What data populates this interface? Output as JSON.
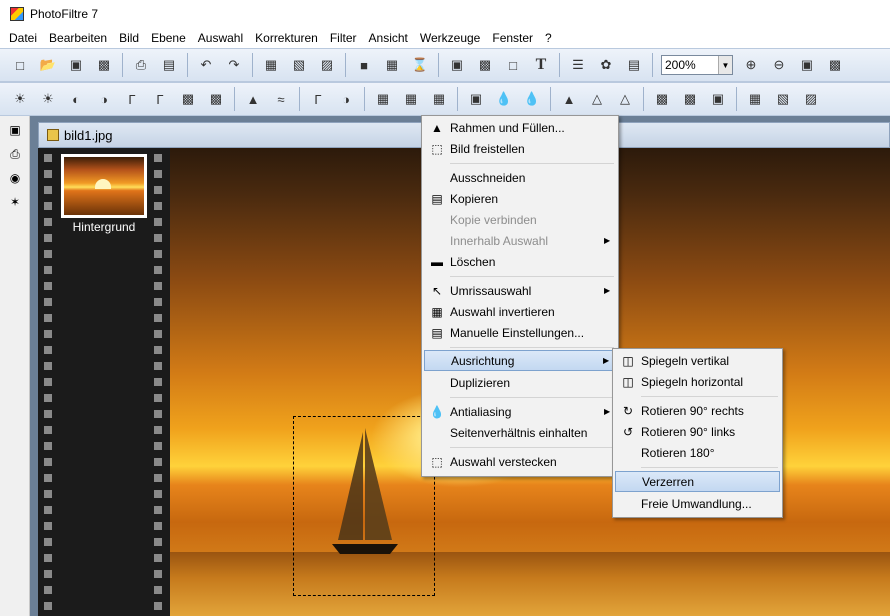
{
  "window": {
    "title": "PhotoFiltre 7"
  },
  "menubar": {
    "items": [
      "Datei",
      "Bearbeiten",
      "Bild",
      "Ebene",
      "Auswahl",
      "Korrekturen",
      "Filter",
      "Ansicht",
      "Werkzeuge",
      "Fenster",
      "?"
    ]
  },
  "toolbar": {
    "zoom_value": "200%"
  },
  "document": {
    "tab_title": "bild1.jpg"
  },
  "layers": {
    "layer_name": "Hintergrund"
  },
  "context_menu": {
    "items": [
      {
        "label": "Rahmen und Füllen...",
        "icon": "paint-bucket-icon",
        "enabled": true
      },
      {
        "label": "Bild freistellen",
        "icon": "crop-selection-icon",
        "enabled": true
      },
      {
        "label": "Ausschneiden",
        "enabled": true
      },
      {
        "label": "Kopieren",
        "icon": "copy-image-icon",
        "enabled": true
      },
      {
        "label": "Kopie verbinden",
        "enabled": false
      },
      {
        "label": "Innerhalb Auswahl",
        "enabled": false,
        "submenu": true
      },
      {
        "label": "Löschen",
        "icon": "eraser-icon",
        "enabled": true
      },
      {
        "label": "Umrissauswahl",
        "icon": "cursor-icon",
        "enabled": true,
        "submenu": true
      },
      {
        "label": "Auswahl invertieren",
        "icon": "invert-selection-icon",
        "enabled": true
      },
      {
        "label": "Manuelle Einstellungen...",
        "icon": "settings-dialog-icon",
        "enabled": true
      },
      {
        "label": "Ausrichtung",
        "enabled": true,
        "submenu": true,
        "highlighted": true
      },
      {
        "label": "Duplizieren",
        "enabled": true
      },
      {
        "label": "Antialiasing",
        "icon": "droplet-icon",
        "enabled": true,
        "submenu": true
      },
      {
        "label": "Seitenverhältnis einhalten",
        "enabled": true
      },
      {
        "label": "Auswahl verstecken",
        "icon": "hide-selection-icon",
        "enabled": true
      }
    ]
  },
  "submenu": {
    "items": [
      {
        "label": "Spiegeln vertikal",
        "icon": "flip-vertical-icon"
      },
      {
        "label": "Spiegeln horizontal",
        "icon": "flip-horizontal-icon"
      },
      {
        "label": "Rotieren 90° rechts",
        "icon": "rotate-right-icon"
      },
      {
        "label": "Rotieren 90° links",
        "icon": "rotate-left-icon"
      },
      {
        "label": "Rotieren 180°"
      },
      {
        "label": "Verzerren",
        "highlighted": true
      },
      {
        "label": "Freie Umwandlung..."
      }
    ]
  },
  "colors": {
    "highlight": "#c3d8f1",
    "workspace": "#6b7f96"
  }
}
